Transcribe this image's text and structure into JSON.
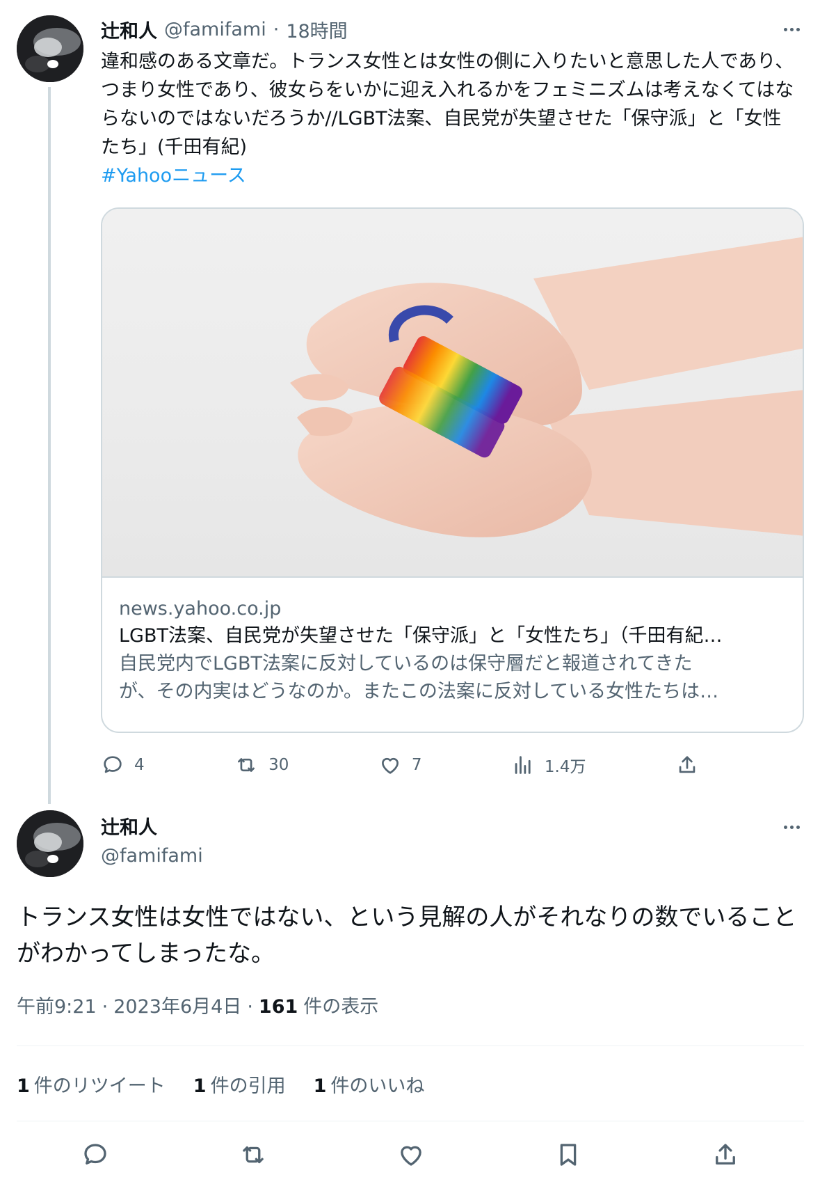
{
  "tweet1": {
    "author_name": "辻和人",
    "author_handle": "@famifami",
    "separator": "·",
    "time_ago": "18時間",
    "text": "違和感のある文章だ。トランス女性とは女性の側に入りたいと意思した人であり、つまり女性であり、彼女らをいかに迎え入れるかをフェミニズムは考えなくてはならないのではないだろうか//LGBT法案、自民党が失望させた「保守派」と「女性たち」(千田有紀)",
    "hashtag": "#Yahooニュース",
    "card": {
      "domain": "news.yahoo.co.jp",
      "title": "LGBT法案、自民党が失望させた「保守派」と「女性たち」（千田有紀…",
      "description_line1": "自民党内でLGBT法案に反対しているのは保守層だと報道されてきた",
      "description_line2": "が、その内実はどうなのか。またこの法案に反対している女性たちは…"
    },
    "actions": {
      "replies": "4",
      "retweets": "30",
      "likes": "7",
      "views": "1.4万"
    }
  },
  "tweet2": {
    "author_name": "辻和人",
    "author_handle": "@famifami",
    "text_line1": "トランス女性は女性ではない、という見解の人がそれなりの数でいること",
    "text_line2": "がわかってしまったな。",
    "time": "午前9:21",
    "sep1": "·",
    "date": "2023年6月4日",
    "sep2": "·",
    "view_count": "161",
    "view_label": "件の表示",
    "stats": {
      "retweets_count": "1",
      "retweets_label": "件のリツイート",
      "quotes_count": "1",
      "quotes_label": "件の引用",
      "likes_count": "1",
      "likes_label": "件のいいね"
    }
  },
  "icons": {
    "reply": "reply-icon",
    "retweet": "retweet-icon",
    "like": "heart-icon",
    "views": "views-icon",
    "share": "share-icon",
    "bookmark": "bookmark-icon",
    "more": "more-icon"
  },
  "colors": {
    "accent": "#1d9bf0",
    "muted": "#536471",
    "text": "#0f1419",
    "border": "#cfd9de"
  }
}
